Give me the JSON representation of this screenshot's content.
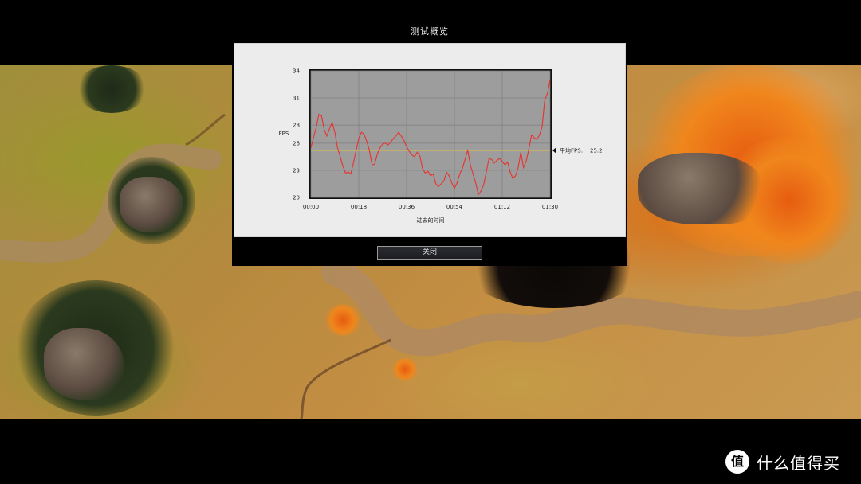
{
  "dialog": {
    "title": "测试概览",
    "close_label": "关闭"
  },
  "chart_data": {
    "type": "line",
    "title": "",
    "ylabel": "FPS",
    "xlabel": "过去的时间",
    "x_ticks": [
      "00:00",
      "00:18",
      "00:36",
      "00:54",
      "01:12",
      "01:30"
    ],
    "x_tick_seconds": [
      0,
      18,
      36,
      54,
      72,
      90
    ],
    "y_ticks": [
      20,
      23,
      26,
      28,
      31,
      34
    ],
    "ylim": [
      20,
      34
    ],
    "xlim": [
      0,
      90
    ],
    "grid": true,
    "series": [
      {
        "color": "#e8322e",
        "x": [
          0,
          2,
          3,
          4,
          5,
          6,
          7,
          8,
          9,
          10,
          11,
          12,
          13,
          14,
          15,
          16,
          17,
          18,
          19,
          20,
          21,
          22,
          23,
          24,
          25,
          26,
          27,
          28,
          29,
          30,
          31,
          32,
          33,
          34,
          35,
          36,
          37,
          38,
          39,
          40,
          41,
          42,
          43,
          44,
          45,
          46,
          47,
          48,
          49,
          50,
          51,
          52,
          53,
          54,
          55,
          56,
          57,
          58,
          59,
          60,
          61,
          62,
          63,
          64,
          65,
          66,
          67,
          68,
          69,
          70,
          71,
          72,
          73,
          74,
          75,
          76,
          77,
          78,
          79,
          80,
          81,
          82,
          83,
          84,
          85,
          86,
          87,
          88,
          89,
          90
        ],
        "y": [
          25.5,
          27.8,
          29.2,
          29.0,
          27.5,
          26.8,
          27.6,
          28.3,
          27.2,
          25.5,
          24.5,
          23.5,
          22.7,
          22.8,
          22.6,
          23.8,
          25.2,
          26.5,
          27.2,
          27.0,
          26.2,
          25.2,
          23.6,
          23.7,
          24.8,
          25.5,
          25.9,
          26.0,
          25.8,
          26.1,
          26.5,
          26.8,
          27.2,
          26.8,
          26.3,
          25.6,
          25.1,
          24.7,
          24.5,
          25.0,
          24.6,
          23.2,
          22.7,
          22.9,
          22.4,
          22.6,
          21.5,
          21.2,
          21.5,
          21.8,
          22.8,
          22.4,
          21.6,
          21.0,
          21.6,
          22.6,
          23.2,
          24.2,
          25.2,
          23.6,
          22.6,
          21.6,
          20.3,
          20.7,
          21.4,
          22.8,
          24.3,
          24.2,
          23.8,
          24.1,
          24.3,
          24.0,
          23.6,
          23.9,
          22.8,
          22.1,
          22.4,
          23.3,
          25.0,
          23.3,
          24.0,
          25.3,
          26.9,
          26.6,
          26.4,
          26.9,
          27.8,
          30.8,
          31.5,
          33.0
        ]
      }
    ],
    "average": {
      "label": "平均FPS:",
      "value": 25.2,
      "value_text": "25.2",
      "color": "#e6c33a"
    }
  },
  "watermark": {
    "logo_glyph": "值",
    "text": "什么值得买"
  }
}
